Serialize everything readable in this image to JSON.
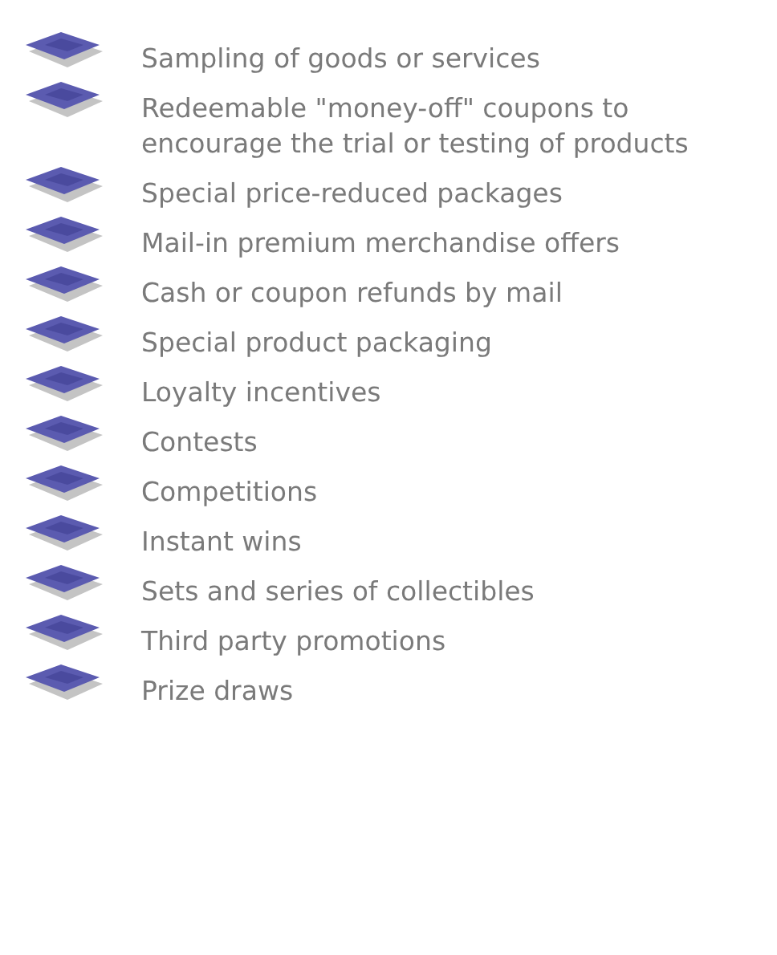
{
  "items": [
    {
      "text": "Sampling of goods or services"
    },
    {
      "text": "Redeemable \"money-off\" coupons to encourage the trial or testing of products"
    },
    {
      "text": "Special price-reduced packages"
    },
    {
      "text": "Mail-in premium merchandise offers"
    },
    {
      "text": "Cash or coupon refunds by mail"
    },
    {
      "text": "Special product packaging"
    },
    {
      "text": "Loyalty incentives"
    },
    {
      "text": "Contests"
    },
    {
      "text": "Competitions"
    },
    {
      "text": "Instant wins"
    },
    {
      "text": "Sets and series of collectibles"
    },
    {
      "text": "Third party promotions"
    },
    {
      "text": "Prize draws"
    }
  ]
}
